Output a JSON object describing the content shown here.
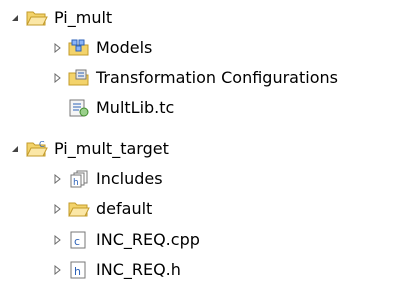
{
  "tree": {
    "projects": [
      {
        "label": "Pi_mult",
        "expanded": true,
        "icon": "folder-open-icon",
        "children": [
          {
            "label": "Models",
            "icon": "models-folder-icon",
            "expandable": true
          },
          {
            "label": "Transformation Configurations",
            "icon": "transformation-config-folder-icon",
            "expandable": true
          },
          {
            "label": "MultLib.tc",
            "icon": "tc-file-icon",
            "expandable": false
          }
        ]
      },
      {
        "label": "Pi_mult_target",
        "expanded": true,
        "icon": "cpp-project-icon",
        "children": [
          {
            "label": "Includes",
            "icon": "includes-icon",
            "expandable": true
          },
          {
            "label": "default",
            "icon": "folder-icon",
            "expandable": true
          },
          {
            "label": "INC_REQ.cpp",
            "icon": "cpp-file-icon",
            "expandable": true
          },
          {
            "label": "INC_REQ.h",
            "icon": "header-file-icon",
            "expandable": true
          }
        ]
      }
    ]
  },
  "colors": {
    "folder_yellow": "#f3d36b",
    "folder_outline": "#c39b2a",
    "expander_gray": "#6b6b6b",
    "file_blue": "#2d62b8"
  }
}
